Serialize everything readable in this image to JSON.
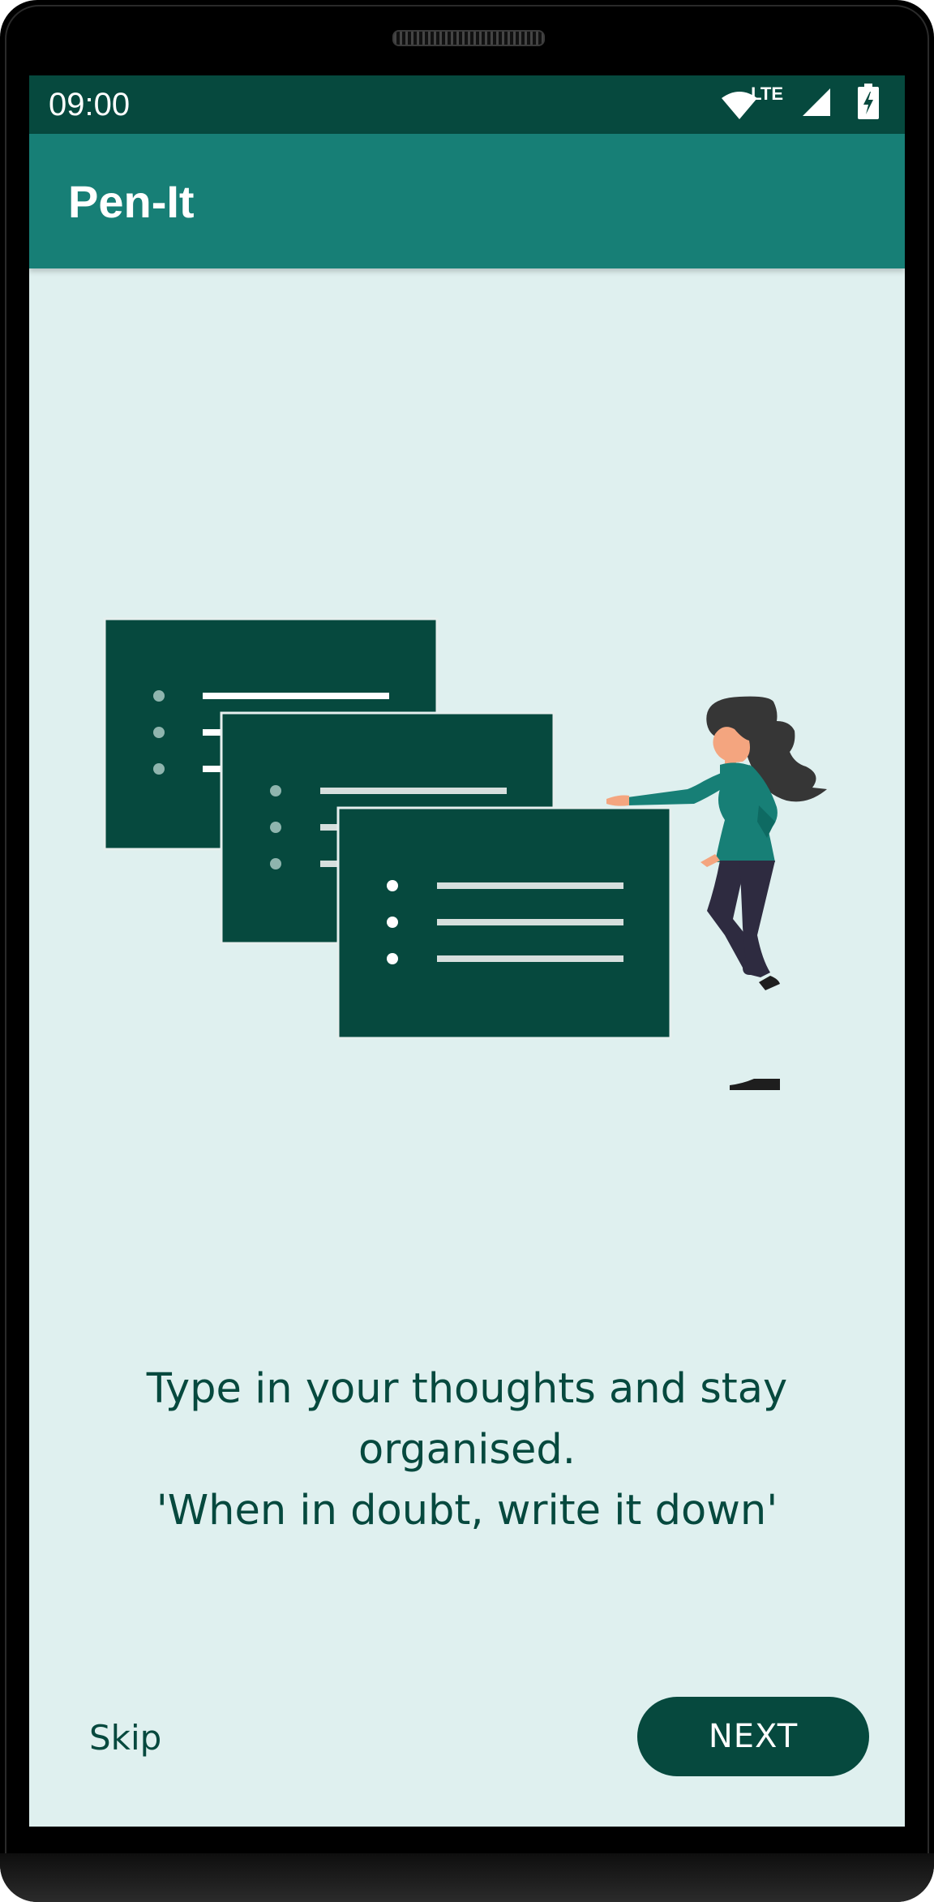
{
  "status_bar": {
    "time": "09:00",
    "network": "LTE",
    "icons": [
      "wifi-icon",
      "signal-icon",
      "battery-charging-icon"
    ]
  },
  "app_bar": {
    "title": "Pen-It"
  },
  "onboarding": {
    "message_line1": "Type in your thoughts and stay",
    "message_line2": "organised.",
    "message_line3": "'When in doubt, write it down'",
    "illustration": "woman-presenting-note-cards"
  },
  "actions": {
    "skip_label": "Skip",
    "next_label": "NEXT"
  },
  "colors": {
    "primary_dark": "#06493e",
    "primary": "#177f76",
    "background": "#dff0ef",
    "accent_skin": "#f4a57f",
    "hair": "#363636",
    "pants": "#2e2b40"
  }
}
